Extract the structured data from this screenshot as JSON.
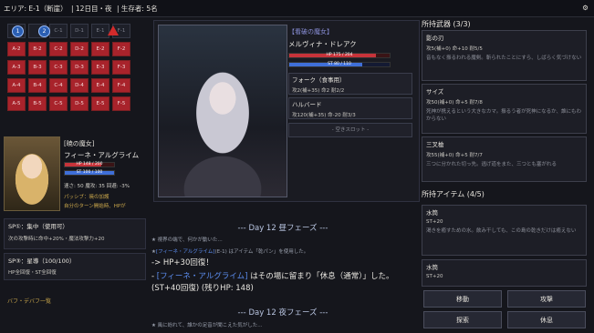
{
  "topbar": {
    "area": "エリア: E-1（断崖）",
    "day": "| 12日目・夜",
    "survivors": "| 生存者: 5名"
  },
  "map": {
    "row_labels": [
      "",
      "C-1",
      "D-1",
      "E-1",
      "F-1"
    ],
    "markers": [
      {
        "label": "1"
      },
      {
        "label": "2"
      }
    ],
    "cells": [
      [
        "",
        "",
        "",
        "",
        ""
      ],
      [
        "A-2",
        "B-2",
        "C-2",
        "D-2",
        "E-2",
        "F-2"
      ],
      [
        "A-3",
        "B-3",
        "C-3",
        "D-3",
        "E-3",
        "F-3"
      ],
      [
        "A-4",
        "B-4",
        "C-4",
        "D-4",
        "E-4",
        "F-4"
      ],
      [
        "A-5",
        "B-5",
        "C-5",
        "D-5",
        "E-5",
        "F-5"
      ]
    ]
  },
  "player": {
    "title": "[暁の魔女]",
    "name": "フィーネ・アルグライム",
    "hp": "HP 148 / 200",
    "hp_ratio": 0.74,
    "st": "ST 100 / 100",
    "st_ratio": 1.0,
    "stats": "速さ: 50  魔攻: 35  回避: -3%",
    "passive": "パッシブ：暁の加護",
    "passive_desc": "自分のターン開始時、HPが"
  },
  "sp": [
    {
      "title": "SP①：集中（使用可）",
      "desc": "次の攻撃時に命中+20%・魔法攻撃力+20"
    },
    {
      "title": "SP③：星導（100/100）",
      "desc": "HP全回復・ST全回復"
    }
  ],
  "buff_label": "バフ・デバフ一覧",
  "enemy": {
    "title": "【看破の魔女】",
    "name": "メルヴィナ・ドレアク",
    "hp": "HP 175 / 204",
    "hp_ratio": 0.86,
    "st": "ST 80 / 110",
    "st_ratio": 0.73,
    "equip": [
      {
        "name": "フォーク（食事用）",
        "stat": "攻2(補+35) 命2 耐2/2"
      },
      {
        "name": "ハルバード",
        "stat": "攻120(補+35) 命-20 耐3/3"
      }
    ],
    "empty_slot": "- 空きスロット -"
  },
  "log": {
    "phase_day": "--- Day 12 昼フェーズ ---",
    "line1": "★ 視界の端で、何かが動いた...",
    "line2_prefix": "★",
    "line2_name": "[フィーネ・アルグライム]",
    "line2_rest": "(E-1) はアイテム「乾パン」を使用した。",
    "line3": "-> HP+30回復！",
    "line4_prefix": "-",
    "line4_name": "[フィーネ・アルグライム]",
    "line4_rest": "はその場に留まり「休息（通常）」した。",
    "line5": "(ST+40回復) (残りHP: 148)",
    "phase_night": "--- Day 12 夜フェーズ ---",
    "line6": "★ 風に紛れて、誰かの足音が聞こえた気がした..."
  },
  "weapons": {
    "title": "所持武器 (3/3)",
    "items": [
      {
        "name": "影の刃",
        "stat": "攻5(補+0) 命+10 耐5/5",
        "desc": "音もなく振るわれる魔剣。斬られたことにすら、しばらく気づけない"
      },
      {
        "name": "サイズ",
        "stat": "攻50(補+0) 命+5 耐7/8",
        "desc": "死神が携えるという大きなカマ。振るう者が死神になるか、誰にもわからない"
      },
      {
        "name": "三叉槍",
        "stat": "攻55(補+0) 命+5 耐7/7",
        "desc": "三つに分かれた切っ先。逃げ道をまた、三つとも塞がれる"
      }
    ]
  },
  "items": {
    "title": "所持アイテム (4/5)",
    "list": [
      {
        "name": "水筒",
        "effect": "ST+20",
        "desc": "渇きを癒すための水。飲み干しても、この島の乾きだけは癒えない"
      },
      {
        "name": "水筒",
        "effect": "ST+20",
        "desc": ""
      }
    ]
  },
  "actions": {
    "move": "移動",
    "attack": "攻撃",
    "search": "探索",
    "rest": "休息"
  }
}
